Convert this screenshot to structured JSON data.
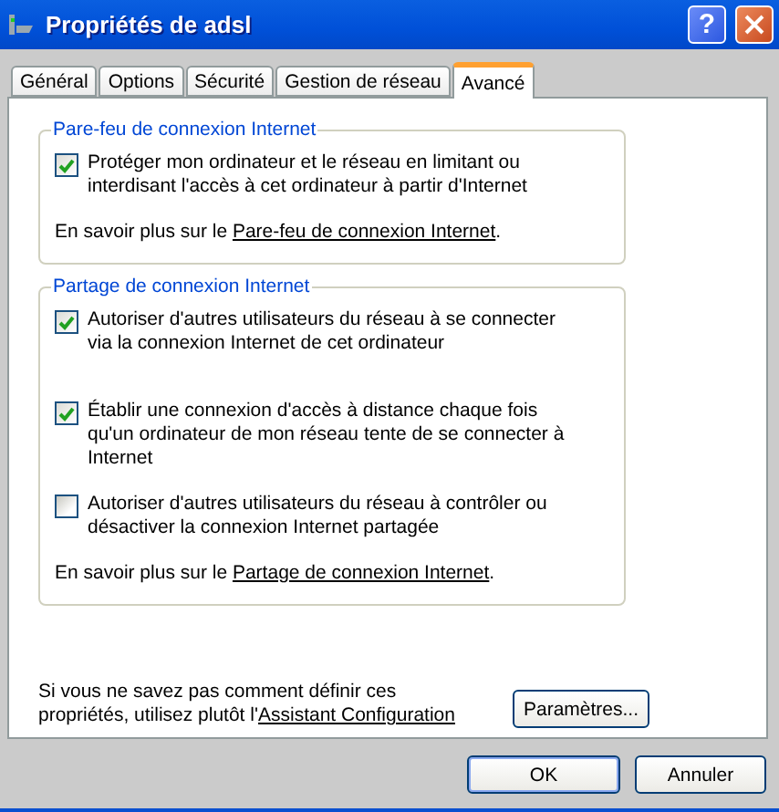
{
  "window": {
    "title": "Propriétés de adsl",
    "help": "?"
  },
  "tabs": [
    {
      "label": "Général",
      "selected": false
    },
    {
      "label": "Options",
      "selected": false
    },
    {
      "label": "Sécurité",
      "selected": false
    },
    {
      "label": "Gestion de réseau",
      "selected": false
    },
    {
      "label": "Avancé",
      "selected": true
    }
  ],
  "groups": [
    {
      "title": "Pare-feu de connexion Internet",
      "options": [
        {
          "label": "Protéger mon ordinateur et le réseau en limitant ou interdisant l'accès à cet ordinateur à partir d'Internet",
          "checked": true
        }
      ],
      "learn_more": {
        "prefix": "En savoir plus sur le ",
        "link": "Pare-feu de connexion Internet",
        "suffix": "."
      }
    },
    {
      "title": "Partage de connexion Internet",
      "options": [
        {
          "label": "Autoriser d'autres utilisateurs du réseau à se connecter via la connexion Internet de cet ordinateur",
          "checked": true
        },
        {
          "label": "Établir une connexion d'accès à distance chaque fois qu'un ordinateur de mon réseau tente de se connecter à Internet",
          "checked": true
        },
        {
          "label": "Autoriser d'autres utilisateurs du réseau à contrôler ou désactiver la connexion Internet partagée",
          "checked": false
        }
      ],
      "learn_more": {
        "prefix": "En savoir plus sur le ",
        "link": "Partage de connexion Internet",
        "suffix": "."
      }
    }
  ],
  "footer": {
    "prefix": "Si vous ne savez pas comment définir ces propriétés, utilisez plutôt l'",
    "link": "Assistant Configuration",
    "button": "Paramètres..."
  },
  "buttons": [
    "OK",
    "Annuler"
  ]
}
